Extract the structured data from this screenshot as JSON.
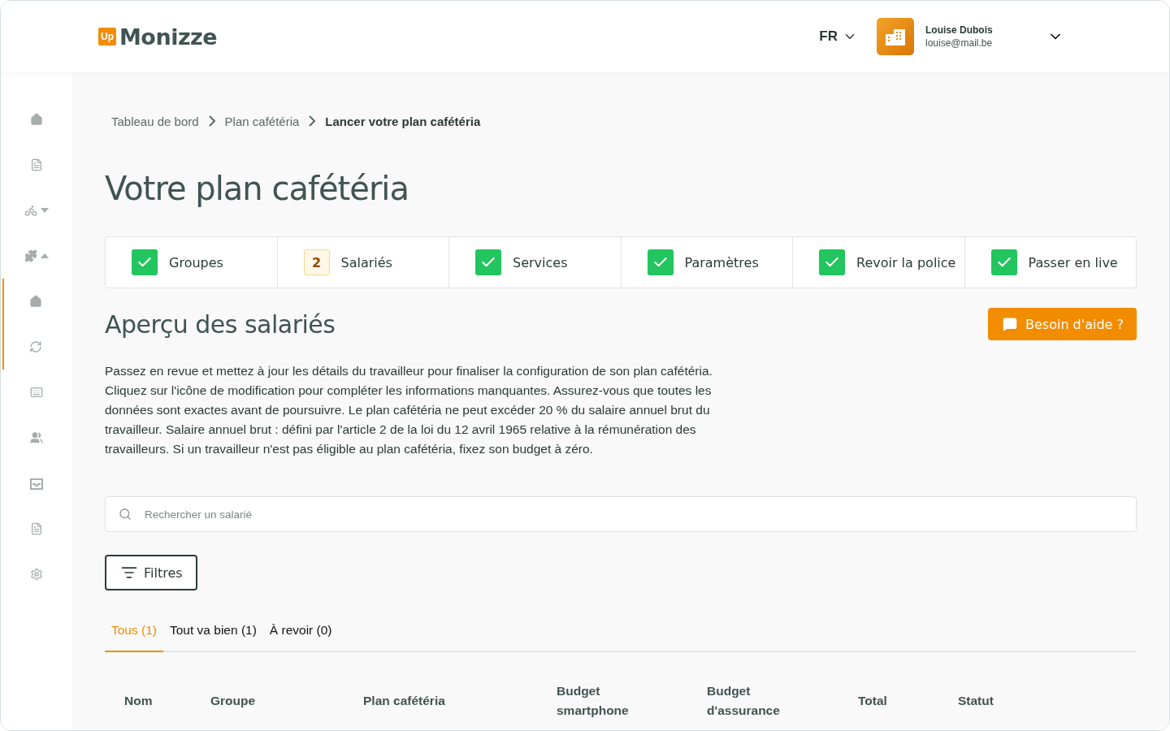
{
  "header": {
    "logo_badge": "Up",
    "logo_text": "Monizze",
    "language": "FR",
    "user": {
      "name": "Louise Dubois",
      "email": "louise@mail.be"
    }
  },
  "sidebar": {
    "menus": [
      {
        "expanded": false
      },
      {
        "expanded": true
      }
    ]
  },
  "breadcrumb": [
    "Tableau de bord",
    "Plan cafétéria",
    "Lancer votre plan cafétéria"
  ],
  "title": "Votre plan cafétéria",
  "steps": [
    {
      "label": "Groupes",
      "kind": "done"
    },
    {
      "label": "Salariés",
      "kind": "number",
      "number": "2"
    },
    {
      "label": "Services",
      "kind": "done"
    },
    {
      "label": "Paramètres",
      "kind": "done"
    },
    {
      "label": "Revoir la police",
      "kind": "done"
    },
    {
      "label": "Passer en live",
      "kind": "done"
    }
  ],
  "section_title": "Aperçu des salariés",
  "help_button": "Besoin d'aide ?",
  "description": "Passez en revue et mettez à jour les détails du travailleur pour finaliser la configuration de son plan cafétéria. Cliquez sur l'icône de modification pour compléter les informations manquantes. Assurez-vous que toutes les données sont exactes avant de poursuivre. Le plan cafétéria ne peut excéder 20 % du salaire annuel brut du travailleur. Salaire annuel brut : défini par l'article 2 de la loi du 12 avril 1965 relative à la rémunération des travailleurs. Si un travailleur n'est pas éligible au plan cafétéria, fixez son budget à zéro.",
  "search": {
    "placeholder": "Rechercher un salarié"
  },
  "filter_button": "Filtres",
  "tabs": [
    {
      "label": "Tous (1)",
      "selected": true
    },
    {
      "label": "Tout va bien (1)",
      "selected": false
    },
    {
      "label": "À revoir (0)",
      "selected": false
    }
  ],
  "table": {
    "columns": [
      "Nom",
      "Groupe",
      "Plan cafétéria",
      "Budget smartphone",
      "Budget d'assurance",
      "Total",
      "Statut"
    ]
  }
}
